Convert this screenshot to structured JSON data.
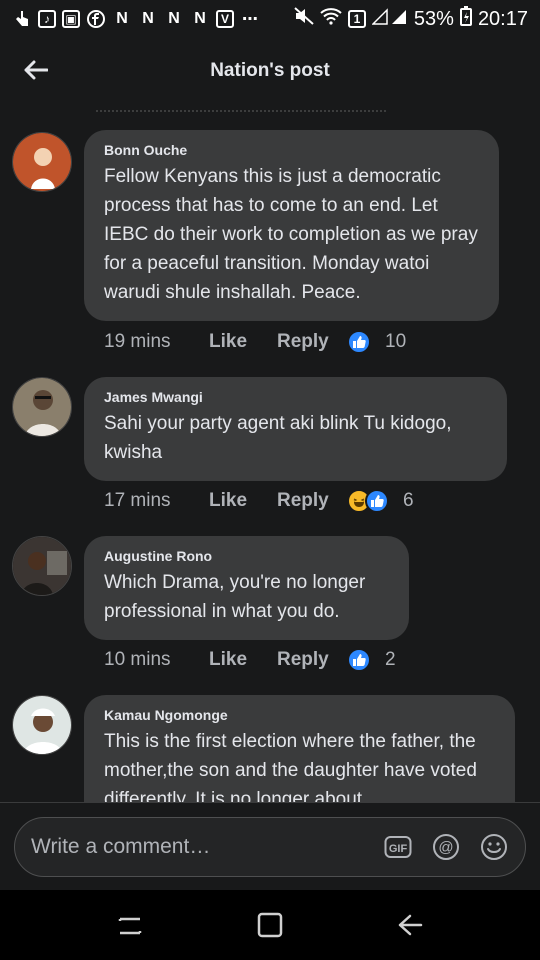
{
  "status_bar": {
    "battery": "53%",
    "time": "20:17",
    "sim_badge": "1",
    "notification_letters": [
      "N",
      "N",
      "N",
      "N",
      "V"
    ],
    "more": "⋯"
  },
  "header": {
    "title": "Nation's post"
  },
  "comments": [
    {
      "author": "Bonn Ouche",
      "text": "Fellow Kenyans this is just a democratic process that has to come to an end. Let IEBC do their work to completion as we pray for a peaceful transition. Monday watoi warudi shule inshallah. Peace.",
      "time": "19 mins",
      "like_label": "Like",
      "reply_label": "Reply",
      "reactions": [
        "like"
      ],
      "reaction_count": "10",
      "avatar_color": "#c0542b"
    },
    {
      "author": "James Mwangi",
      "text": "Sahi your party agent aki blink Tu kidogo, kwisha",
      "time": "17 mins",
      "like_label": "Like",
      "reply_label": "Reply",
      "reactions": [
        "haha",
        "like"
      ],
      "reaction_count": "6",
      "avatar_color": "#8a7f6c"
    },
    {
      "author": "Augustine Rono",
      "text": "Which Drama, you're no longer professional in what you do.",
      "time": "10 mins",
      "like_label": "Like",
      "reply_label": "Reply",
      "reactions": [
        "like"
      ],
      "reaction_count": "2",
      "avatar_color": "#3b3532"
    },
    {
      "author": "Kamau Ngomonge",
      "text": "This is the first election where the father, the mother,the son and the daughter have voted differently. It is no longer about",
      "avatar_color": "#dfe6e4"
    }
  ],
  "composer": {
    "placeholder": "Write a comment…",
    "gif_label": "GIF",
    "mention_label": "@"
  },
  "colors": {
    "background": "#18191a",
    "bubble": "#3a3b3c",
    "like_blue": "#2d88ff",
    "haha_yellow": "#f7b928"
  }
}
